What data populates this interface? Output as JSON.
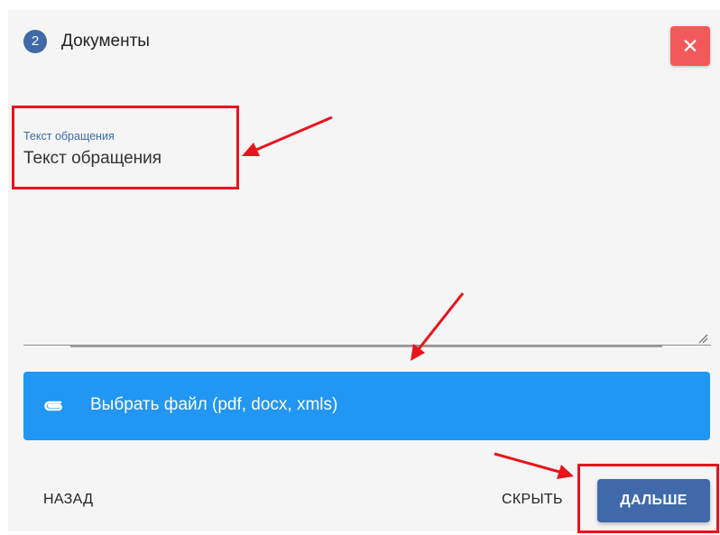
{
  "step": {
    "number": "2",
    "title": "Документы"
  },
  "close_button": {
    "label": "✕"
  },
  "message_field": {
    "label": "Текст обращения",
    "value": "Текст обращения"
  },
  "file_button": {
    "label": "Выбрать файл (pdf, docx, xmls)",
    "icon": "paperclip-icon"
  },
  "footer": {
    "back_label": "НАЗАД",
    "hide_label": "СКРЫТЬ",
    "next_label": "ДАЛЬШЕ"
  },
  "colors": {
    "primary": "#3f69a8",
    "file_button": "#2196f3",
    "close_button": "#f25a5a",
    "annotation": "#e8141c",
    "panel": "#f5f5f5"
  }
}
